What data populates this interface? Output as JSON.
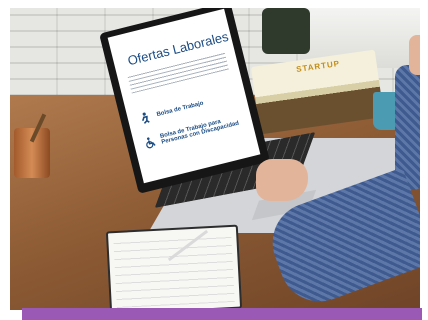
{
  "screen": {
    "title": "Ofertas Laborales",
    "items": [
      {
        "label": "Bolsa de Trabajo",
        "icon": "person-walking-icon"
      },
      {
        "label": "Bolsa de Trabajo para Personas con Discapacidad",
        "icon": "wheelchair-icon"
      }
    ]
  },
  "books": {
    "cover_text": "STARTUP"
  },
  "colors": {
    "frame_bar": "#9b59b6",
    "screen_title": "#1b4c84"
  }
}
